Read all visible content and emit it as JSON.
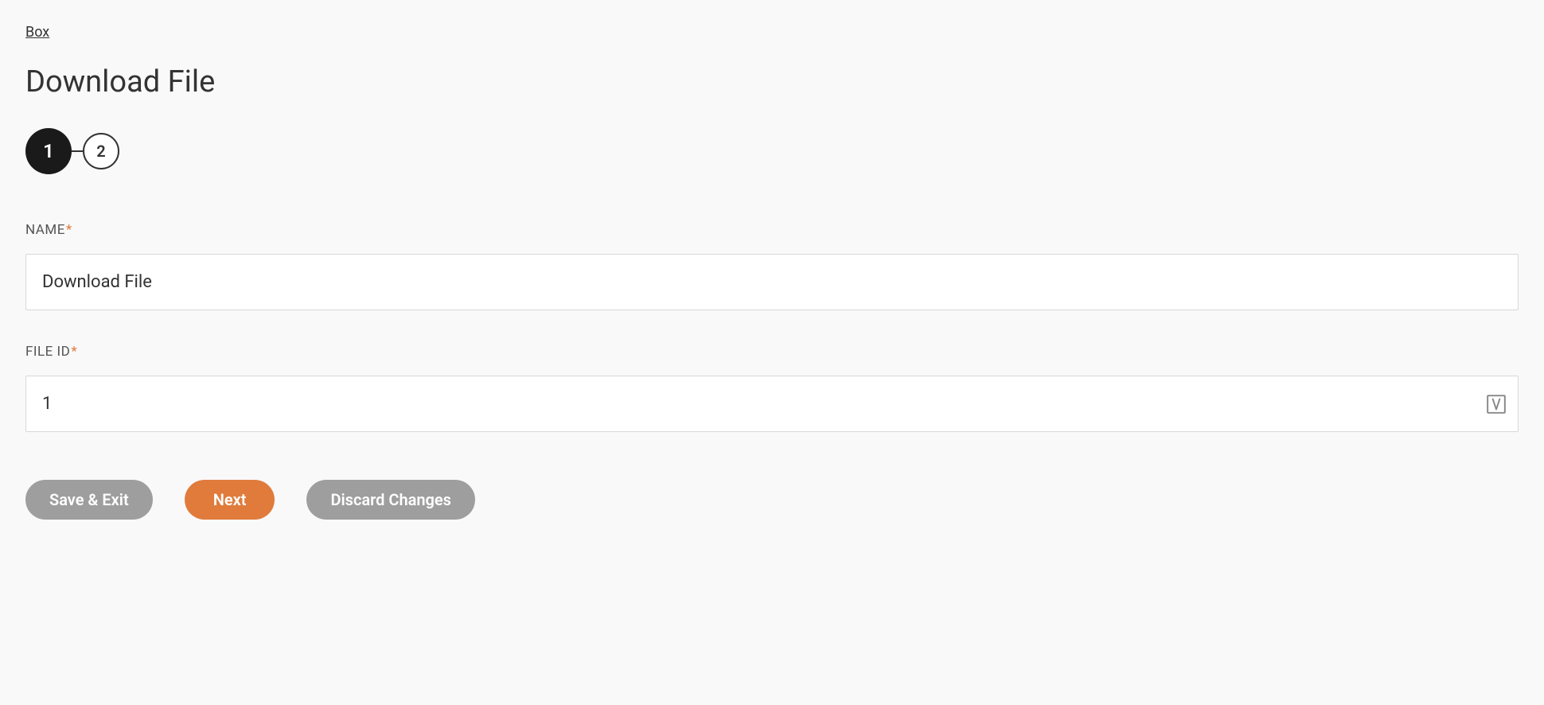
{
  "breadcrumb": {
    "label": "Box"
  },
  "page": {
    "title": "Download File"
  },
  "stepper": {
    "steps": [
      "1",
      "2"
    ],
    "activeIndex": 0
  },
  "form": {
    "name": {
      "label": "NAME",
      "required": true,
      "value": "Download File"
    },
    "fileId": {
      "label": "FILE ID",
      "required": true,
      "value": "1"
    }
  },
  "buttons": {
    "saveExit": "Save & Exit",
    "next": "Next",
    "discard": "Discard Changes"
  },
  "requiredMark": "*"
}
